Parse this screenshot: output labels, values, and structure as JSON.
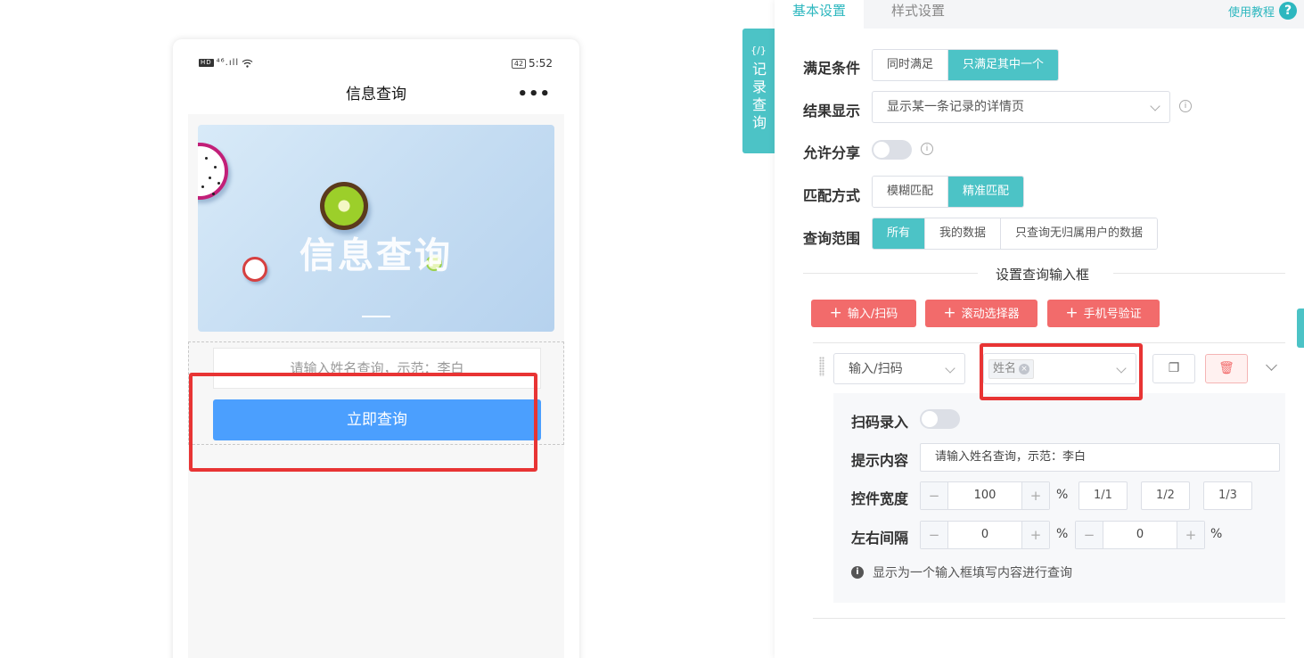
{
  "phone": {
    "status_left": "⁴⁶.ıll",
    "status_hd": "HD",
    "battery": "42",
    "time": "5:52",
    "title": "信息查询",
    "more": "•••",
    "banner_title": "信息查询",
    "input_placeholder": "请输入姓名查询，示范：李白",
    "submit_label": "立即查询"
  },
  "side_tab": {
    "code": "{/}",
    "label": "记录查询"
  },
  "tabs": {
    "basic": "基本设置",
    "style": "样式设置",
    "help": "使用教程",
    "help_icon": "?"
  },
  "settings": {
    "condition": {
      "label": "满足条件",
      "options": [
        "同时满足",
        "只满足其中一个"
      ],
      "selected": "只满足其中一个"
    },
    "result": {
      "label": "结果显示",
      "value": "显示某一条记录的详情页"
    },
    "share": {
      "label": "允许分享",
      "enabled": false
    },
    "match": {
      "label": "匹配方式",
      "options": [
        "模糊匹配",
        "精准匹配"
      ],
      "selected": "精准匹配"
    },
    "scope": {
      "label": "查询范围",
      "options": [
        "所有",
        "我的数据",
        "只查询无归属用户的数据"
      ],
      "selected": "所有"
    }
  },
  "section_title": "设置查询输入框",
  "add_buttons": [
    "输入/扫码",
    "滚动选择器",
    "手机号验证"
  ],
  "field": {
    "type": "输入/扫码",
    "tag": "姓名",
    "copy_icon": "❐",
    "delete_icon": "🗑"
  },
  "detail": {
    "scan_label": "扫码录入",
    "scan_enabled": false,
    "hint_label": "提示内容",
    "hint_value": "请输入姓名查询，示范：李白",
    "width_label": "控件宽度",
    "width_value": "100",
    "percent": "%",
    "fractions": [
      "1/1",
      "1/2",
      "1/3"
    ],
    "gap_label": "左右间隔",
    "gap_left": "0",
    "gap_right": "0",
    "minus": "−",
    "plus": "+",
    "info_text": "显示为一个输入框填写内容进行查询"
  },
  "colors": {
    "accent": "#4cc3c6",
    "danger": "#f26b6b",
    "primary": "#4b9ffe",
    "highlight": "#e83434"
  }
}
